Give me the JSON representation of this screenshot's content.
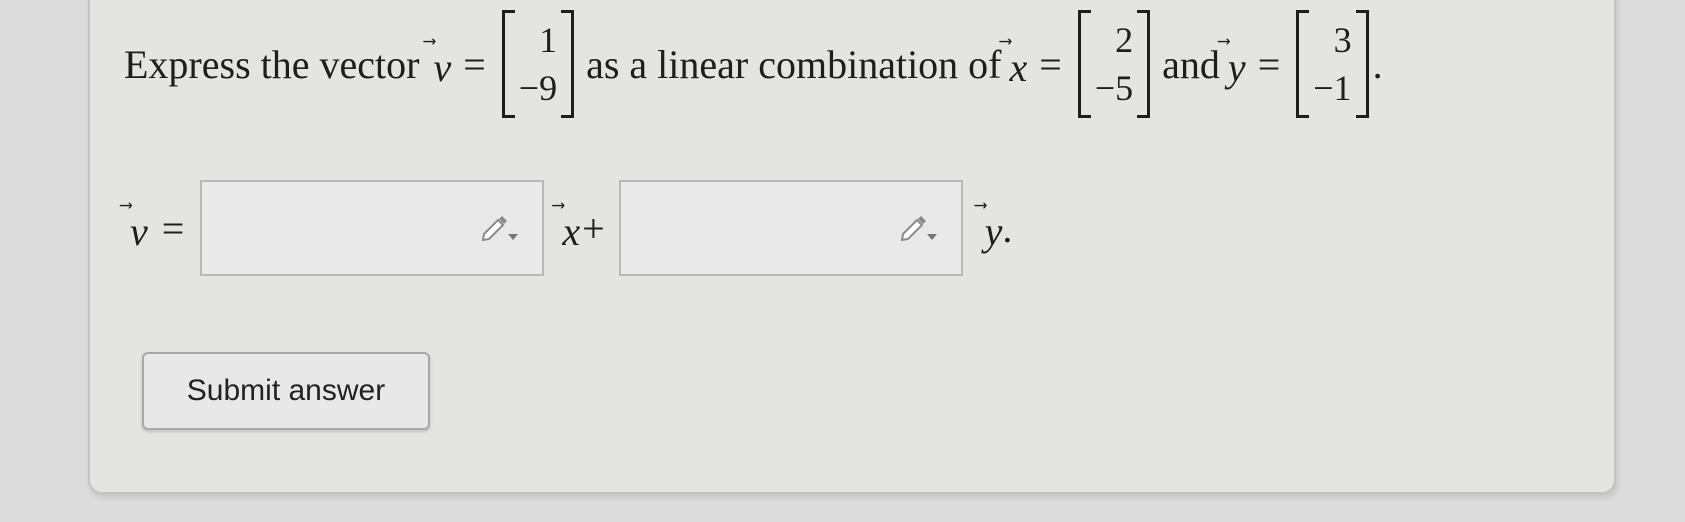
{
  "question": {
    "prefix": "Express the vector",
    "v_symbol": "v",
    "equals": "=",
    "v_entries": [
      "1",
      "−9"
    ],
    "middle_text": "as a linear combination of",
    "x_symbol": "x",
    "x_entries": [
      "2",
      "−5"
    ],
    "and_text": "and",
    "y_symbol": "y",
    "y_entries": [
      "3",
      "−1"
    ],
    "end_punct": "."
  },
  "answer": {
    "lhs_symbol": "v",
    "equals": "=",
    "coef1_value": "",
    "x_symbol": "x",
    "plus": "+",
    "coef2_value": "",
    "y_symbol": "y",
    "end_punct": "."
  },
  "submit_label": "Submit answer",
  "icons": {
    "input_tool": "pencil-dropdown-icon"
  }
}
